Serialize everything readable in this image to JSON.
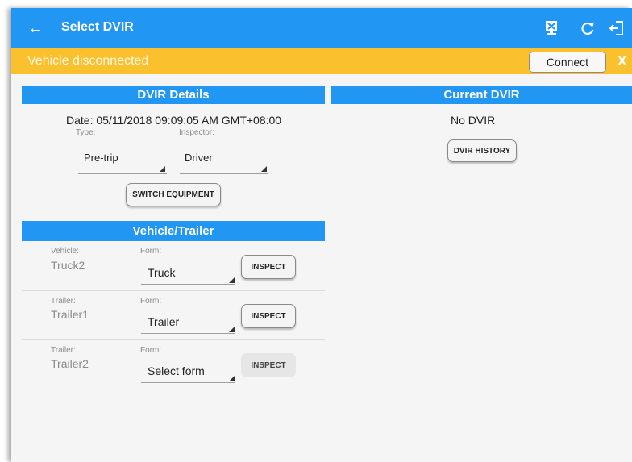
{
  "appbar": {
    "title": "Select DVIR",
    "back_icon": "arrow-left-icon",
    "icons": [
      "sync-device-icon",
      "refresh-icon",
      "logout-icon"
    ],
    "color": "#2196f3"
  },
  "banner": {
    "message": "Vehicle disconnected",
    "connect_label": "Connect",
    "close_label": "X",
    "color": "#fbc02d"
  },
  "dvir_details": {
    "header": "DVIR Details",
    "date": "Date: 05/11/2018 09:09:05 AM GMT+08:00",
    "type_label": "Type:",
    "type_value": "Pre-trip",
    "inspector_label": "Inspector:",
    "inspector_value": "Driver",
    "switch_equipment_label": "SWITCH EQUIPMENT"
  },
  "current_dvir": {
    "header": "Current DVIR",
    "status": "No DVIR",
    "history_label": "DVIR HISTORY"
  },
  "vehicle_trailer": {
    "header": "Vehicle/Trailer",
    "rows": [
      {
        "kind_label": "Vehicle:",
        "name": "Truck2",
        "form_label": "Form:",
        "form_value": "Truck",
        "inspect_label": "INSPECT"
      },
      {
        "kind_label": "Trailer:",
        "name": "Trailer1",
        "form_label": "Form:",
        "form_value": "Trailer",
        "inspect_label": "INSPECT"
      },
      {
        "kind_label": "Trailer:",
        "name": "Trailer2",
        "form_label": "Form:",
        "form_value": "Select form",
        "inspect_label": "INSPECT"
      }
    ]
  }
}
